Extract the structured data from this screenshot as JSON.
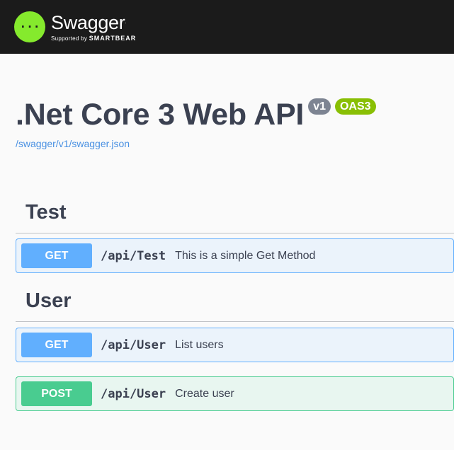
{
  "topbar": {
    "brand_name": "Swagger",
    "brand_tm": ".",
    "supported_by": "Supported by",
    "supporter": "SMARTBEAR",
    "logo_icon": "swagger-braces-icon",
    "colors": {
      "background": "#1b1b1b",
      "logo": "#85ea2d"
    }
  },
  "info": {
    "title": ".Net Core 3 Web API",
    "version_badge": "v1",
    "oas_badge": "OAS3",
    "spec_link": "/swagger/v1/swagger.json"
  },
  "tags": [
    {
      "name": "Test",
      "operations": [
        {
          "method": "GET",
          "path": "/api/Test",
          "summary": "This is a simple Get Method"
        }
      ]
    },
    {
      "name": "User",
      "operations": [
        {
          "method": "GET",
          "path": "/api/User",
          "summary": "List users"
        },
        {
          "method": "POST",
          "path": "/api/User",
          "summary": "Create user"
        }
      ]
    }
  ],
  "colors": {
    "get": "#61affe",
    "post": "#49cc90",
    "link": "#4990e2",
    "text": "#3b4151"
  }
}
